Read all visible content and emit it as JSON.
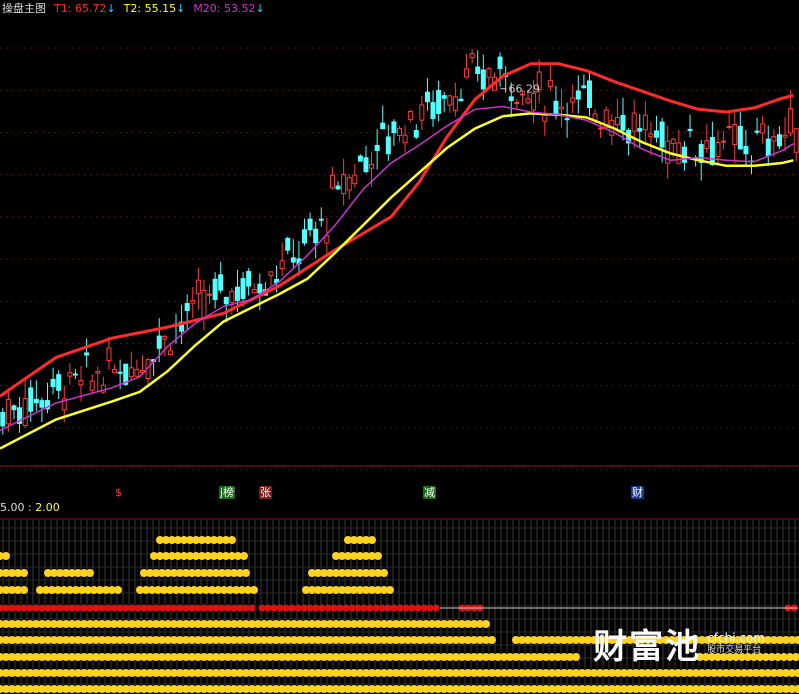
{
  "legend": {
    "title": "操盘主图",
    "t1_label": "T1:",
    "t1_value": "65.72",
    "t1_arrow": "↓",
    "t2_label": "T2:",
    "t2_value": "55.15",
    "t2_arrow": "↓",
    "m20_label": "M20:",
    "m20_value": "53.52",
    "m20_arrow": "↓",
    "colors": {
      "t1": "#ff2a2a",
      "t2": "#ffff30",
      "m20": "#cc33cc",
      "arrow": "#33ccff"
    }
  },
  "indicator_legend": {
    "left": "5.00",
    "sep": ":",
    "right": "2.00"
  },
  "signals": [
    {
      "text": "$",
      "color": "#ff3333",
      "bg": "transparent"
    },
    {
      "text": "j榜",
      "color": "#ffffff",
      "bg": "#1a6a1a"
    },
    {
      "text": "张",
      "color": "#ffffff",
      "bg": "#7a1a1a"
    },
    {
      "text": "减",
      "color": "#ffffff",
      "bg": "#1a6a1a"
    },
    {
      "text": "财",
      "color": "#ffffff",
      "bg": "#1a3a8a"
    }
  ],
  "watermark": {
    "logo": "财富池",
    "site": "cfchi.com",
    "slogan": "股市交易平台"
  },
  "chart_data": {
    "type": "candlestick",
    "annotations": [
      {
        "text": "66.29",
        "x": 91,
        "y": 66.29
      }
    ],
    "series": [
      {
        "name": "T1",
        "color": "#ff2a2a",
        "values": [
          [
            0,
            44.0
          ],
          [
            10,
            46.8
          ],
          [
            20,
            48.2
          ],
          [
            30,
            49.0
          ],
          [
            40,
            50.0
          ],
          [
            50,
            52.0
          ],
          [
            60,
            54.6
          ],
          [
            70,
            57.0
          ],
          [
            75,
            59.5
          ],
          [
            80,
            62.8
          ],
          [
            85,
            65.5
          ],
          [
            90,
            67.2
          ],
          [
            95,
            68.1
          ],
          [
            100,
            68.1
          ],
          [
            105,
            67.6
          ],
          [
            110,
            66.8
          ],
          [
            115,
            66.1
          ],
          [
            120,
            65.4
          ],
          [
            125,
            64.8
          ],
          [
            130,
            64.6
          ],
          [
            135,
            64.9
          ],
          [
            140,
            65.6
          ],
          [
            142,
            65.8
          ]
        ]
      },
      {
        "name": "T2",
        "color": "#ffff30",
        "values": [
          [
            0,
            40.2
          ],
          [
            10,
            42.3
          ],
          [
            20,
            43.6
          ],
          [
            25,
            44.3
          ],
          [
            30,
            45.8
          ],
          [
            35,
            47.7
          ],
          [
            40,
            49.4
          ],
          [
            45,
            50.4
          ],
          [
            50,
            51.4
          ],
          [
            55,
            52.5
          ],
          [
            60,
            54.4
          ],
          [
            65,
            56.4
          ],
          [
            70,
            58.4
          ],
          [
            75,
            60.2
          ],
          [
            80,
            62.0
          ],
          [
            85,
            63.4
          ],
          [
            90,
            64.3
          ],
          [
            95,
            64.5
          ],
          [
            100,
            64.4
          ],
          [
            105,
            64.2
          ],
          [
            110,
            63.4
          ],
          [
            115,
            62.4
          ],
          [
            120,
            61.6
          ],
          [
            125,
            61.1
          ],
          [
            130,
            60.7
          ],
          [
            135,
            60.7
          ],
          [
            140,
            60.9
          ],
          [
            142,
            61.1
          ]
        ]
      },
      {
        "name": "M20",
        "color": "#cc33cc",
        "values": [
          [
            0,
            41.5
          ],
          [
            10,
            43.5
          ],
          [
            20,
            44.6
          ],
          [
            25,
            45.4
          ],
          [
            30,
            47.6
          ],
          [
            35,
            49.3
          ],
          [
            40,
            50.5
          ],
          [
            45,
            51.0
          ],
          [
            50,
            52.3
          ],
          [
            55,
            54.2
          ],
          [
            60,
            56.4
          ],
          [
            65,
            59.0
          ],
          [
            70,
            60.9
          ],
          [
            75,
            62.2
          ],
          [
            80,
            63.6
          ],
          [
            85,
            64.8
          ],
          [
            90,
            65.0
          ],
          [
            95,
            64.6
          ],
          [
            100,
            64.4
          ],
          [
            105,
            64.0
          ],
          [
            110,
            63.1
          ],
          [
            115,
            61.9
          ],
          [
            120,
            61.1
          ],
          [
            125,
            61.3
          ],
          [
            130,
            61.1
          ],
          [
            135,
            61.0
          ],
          [
            140,
            61.8
          ],
          [
            142,
            62.3
          ]
        ]
      }
    ],
    "candles_note": "approximate daily OHLC derived from visible price path",
    "ylim": [
      39,
      72
    ],
    "xlim": [
      0,
      143
    ],
    "indicator": {
      "type": "stacked-dot-bars",
      "colors": {
        "yellow": "#ffd21f",
        "red": "#e01010"
      }
    }
  }
}
